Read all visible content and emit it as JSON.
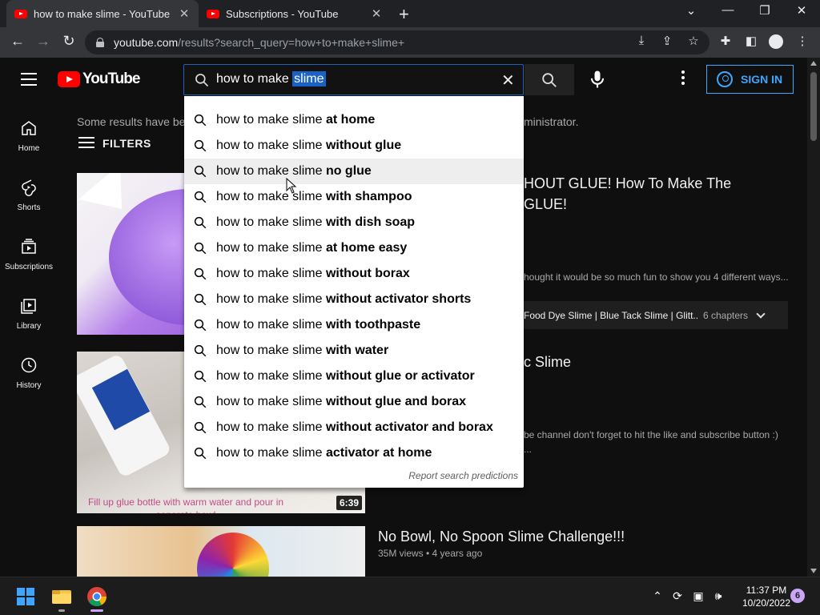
{
  "browser": {
    "tabs": [
      {
        "title": "how to make slime - YouTube",
        "close": "✕"
      },
      {
        "title": "Subscriptions - YouTube",
        "close": "✕"
      }
    ],
    "new_tab": "+",
    "url_host": "youtube.com",
    "url_path": "/results?search_query=how+to+make+slime+"
  },
  "youtube": {
    "logo_text": "YouTube",
    "search": {
      "query_prefix": "how to make",
      "query_selected": "slime"
    },
    "sign_in": "SIGN IN"
  },
  "guide": [
    {
      "label": "Home",
      "icon": "home-icon"
    },
    {
      "label": "Shorts",
      "icon": "shorts-icon"
    },
    {
      "label": "Subscriptions",
      "icon": "subscriptions-icon"
    },
    {
      "label": "Library",
      "icon": "library-icon"
    },
    {
      "label": "History",
      "icon": "history-icon"
    }
  ],
  "content": {
    "notice_start": "Some results have be",
    "notice_end": "ministrator.",
    "filters": "FILTERS",
    "video1": {
      "title_line1": "HOUT GLUE! How To Make The",
      "title_line2": "GLUE!",
      "desc": "hought it would be so much fun to show you 4 different ways...",
      "chapters_text": "Food Dye Slime | Blue Tack Slime | Glitt...",
      "chapters_count": "6 chapters"
    },
    "video2": {
      "title": "c Slime",
      "desc_line1": "be channel don't forget to hit the like and subscribe button :)",
      "desc_line2": "...",
      "thumb_caption": "Fill up glue bottle with warm water and pour in seperate bowl",
      "duration": "6:39"
    },
    "video3": {
      "title": "No Bowl, No Spoon Slime Challenge!!!",
      "meta": "35M views • 4 years ago"
    }
  },
  "suggestions": {
    "prefix": "how to make slime ",
    "items": [
      "at home",
      "without glue",
      "no glue",
      "with shampoo",
      "with dish soap",
      "at home easy",
      "without borax",
      "without activator shorts",
      "with toothpaste",
      "with water",
      "without glue or activator",
      "without glue and borax",
      "without activator and borax",
      "activator at home"
    ],
    "hovered_index": 2,
    "report": "Report search predictions"
  },
  "taskbar": {
    "time": "11:37 PM",
    "date": "10/20/2022",
    "notifications": "6"
  }
}
